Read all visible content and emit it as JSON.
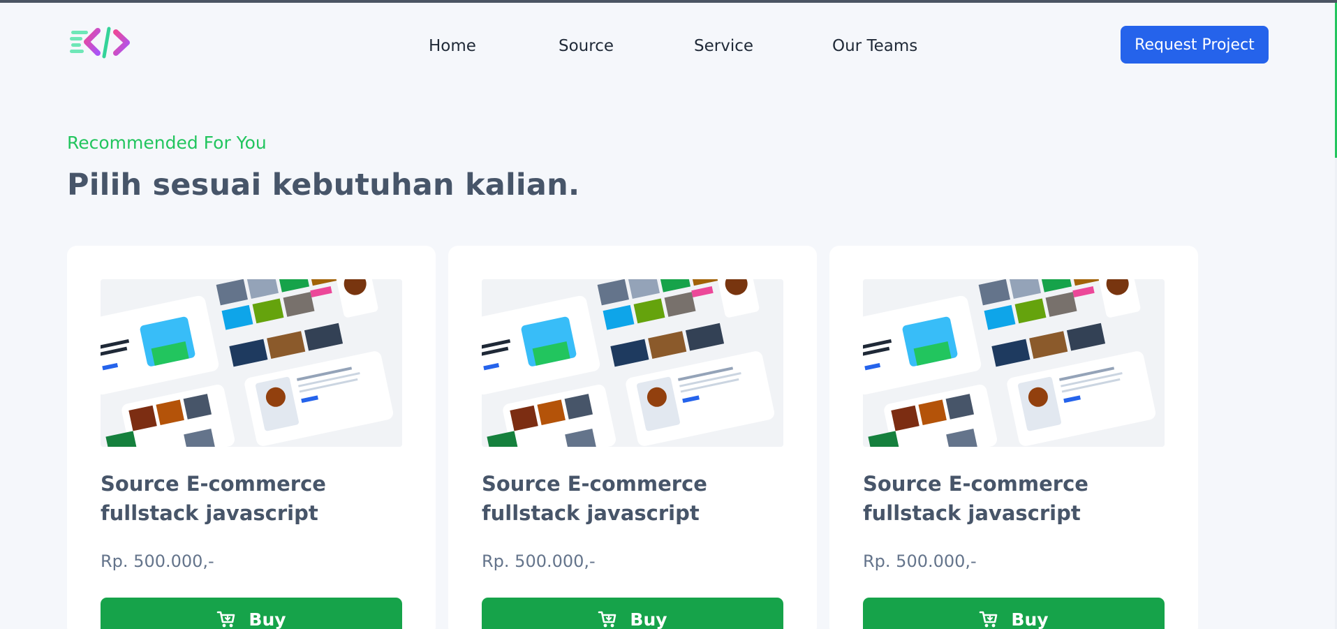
{
  "nav": {
    "links": [
      "Home",
      "Source",
      "Service",
      "Our Teams"
    ],
    "cta_label": "Request Project"
  },
  "section": {
    "eyebrow": "Recommended For You",
    "headline": "Pilih sesuai kebutuhan kalian."
  },
  "cards": [
    {
      "title": "Source E-commerce fullstack javascript",
      "price": "Rp. 500.000,-",
      "button_label": "Buy"
    },
    {
      "title": "Source E-commerce fullstack javascript",
      "price": "Rp. 500.000,-",
      "button_label": "Buy"
    },
    {
      "title": "Source E-commerce fullstack javascript",
      "price": "Rp. 500.000,-",
      "button_label": "Buy"
    }
  ],
  "colors": {
    "primary_blue": "#2563eb",
    "accent_green": "#22c55e",
    "buy_green": "#16a34a",
    "heading": "#475569",
    "background": "#f5f7fb"
  },
  "icons": {
    "logo": "code-brackets-logo",
    "buy": "cart-icon"
  }
}
